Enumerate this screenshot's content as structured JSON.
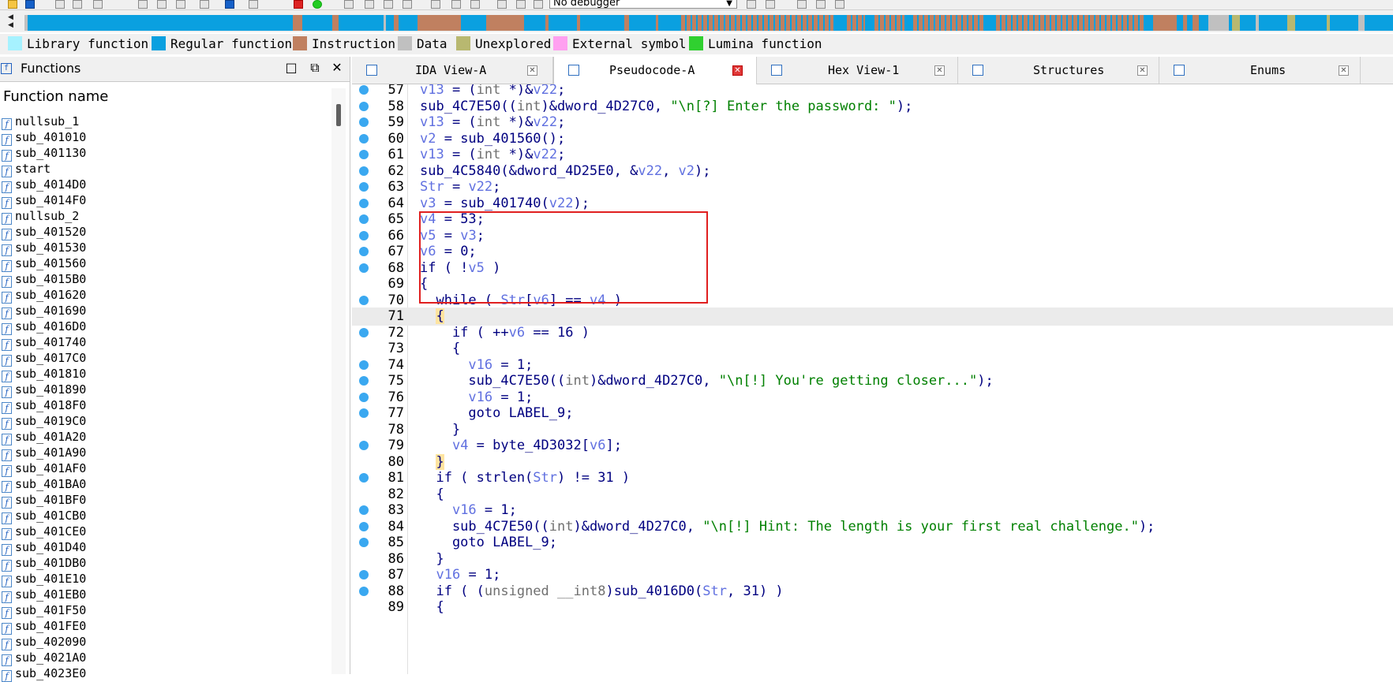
{
  "toolbar": {
    "debugger_label": "No debugger"
  },
  "legend": [
    {
      "label": "Library function",
      "color": "#a6f2ff"
    },
    {
      "label": "Regular function",
      "color": "#0aa0e0"
    },
    {
      "label": "Instruction",
      "color": "#c08060"
    },
    {
      "label": "Data",
      "color": "#c0c0c0"
    },
    {
      "label": "Unexplored",
      "color": "#b8b870"
    },
    {
      "label": "External symbol",
      "color": "#ffa0f0"
    },
    {
      "label": "Lumina function",
      "color": "#30d030"
    }
  ],
  "functions_panel": {
    "title": "Functions",
    "column_header": "Function name",
    "items": [
      "nullsub_1",
      "sub_401010",
      "sub_401130",
      "start",
      "sub_4014D0",
      "sub_4014F0",
      "nullsub_2",
      "sub_401520",
      "sub_401530",
      "sub_401560",
      "sub_4015B0",
      "sub_401620",
      "sub_401690",
      "sub_4016D0",
      "sub_401740",
      "sub_4017C0",
      "sub_401810",
      "sub_401890",
      "sub_4018F0",
      "sub_4019C0",
      "sub_401A20",
      "sub_401A90",
      "sub_401AF0",
      "sub_401BA0",
      "sub_401BF0",
      "sub_401CB0",
      "sub_401CE0",
      "sub_401D40",
      "sub_401DB0",
      "sub_401E10",
      "sub_401EB0",
      "sub_401F50",
      "sub_401FE0",
      "sub_402090",
      "sub_4021A0",
      "sub_4023E0"
    ]
  },
  "tabs": [
    {
      "label": "IDA View-A",
      "active": false
    },
    {
      "label": "Pseudocode-A",
      "active": true
    },
    {
      "label": "Hex View-1",
      "active": false
    },
    {
      "label": "Structures",
      "active": false
    },
    {
      "label": "Enums",
      "active": false
    }
  ],
  "code": {
    "lines": [
      {
        "no": "57",
        "dot": true,
        "text": "v13 = (int *)&v22;"
      },
      {
        "no": "58",
        "dot": true,
        "text": "sub_4C7E50((int)&dword_4D27C0, \"\\n[?] Enter the password: \");"
      },
      {
        "no": "59",
        "dot": true,
        "text": "v13 = (int *)&v22;"
      },
      {
        "no": "60",
        "dot": true,
        "text": "v2 = sub_401560();"
      },
      {
        "no": "61",
        "dot": true,
        "text": "v13 = (int *)&v22;"
      },
      {
        "no": "62",
        "dot": true,
        "text": "sub_4C5840(&dword_4D25E0, &v22, v2);"
      },
      {
        "no": "63",
        "dot": true,
        "text": "Str = v22;"
      },
      {
        "no": "64",
        "dot": true,
        "text": "v3 = sub_401740(v22);"
      },
      {
        "no": "65",
        "dot": true,
        "text": "v4 = 53;"
      },
      {
        "no": "66",
        "dot": true,
        "text": "v5 = v3;"
      },
      {
        "no": "67",
        "dot": true,
        "text": "v6 = 0;"
      },
      {
        "no": "68",
        "dot": true,
        "text": "if ( !v5 )"
      },
      {
        "no": "69",
        "dot": false,
        "text": "{"
      },
      {
        "no": "70",
        "dot": true,
        "text": "  while ( Str[v6] == v4 )"
      },
      {
        "no": "71",
        "dot": false,
        "text": "  {"
      },
      {
        "no": "72",
        "dot": true,
        "text": "    if ( ++v6 == 16 )"
      },
      {
        "no": "73",
        "dot": false,
        "text": "    {"
      },
      {
        "no": "74",
        "dot": true,
        "text": "      v16 = 1;"
      },
      {
        "no": "75",
        "dot": true,
        "text": "      sub_4C7E50((int)&dword_4D27C0, \"\\n[!] You're getting closer...\");"
      },
      {
        "no": "76",
        "dot": true,
        "text": "      v16 = 1;"
      },
      {
        "no": "77",
        "dot": true,
        "text": "      goto LABEL_9;"
      },
      {
        "no": "78",
        "dot": false,
        "text": "    }"
      },
      {
        "no": "79",
        "dot": true,
        "text": "    v4 = byte_4D3032[v6];"
      },
      {
        "no": "80",
        "dot": false,
        "text": "  }"
      },
      {
        "no": "81",
        "dot": true,
        "text": "  if ( strlen(Str) != 31 )"
      },
      {
        "no": "82",
        "dot": false,
        "text": "  {"
      },
      {
        "no": "83",
        "dot": true,
        "text": "    v16 = 1;"
      },
      {
        "no": "84",
        "dot": true,
        "text": "    sub_4C7E50((int)&dword_4D27C0, \"\\n[!] Hint: The length is your first real challenge.\");"
      },
      {
        "no": "85",
        "dot": true,
        "text": "    goto LABEL_9;"
      },
      {
        "no": "86",
        "dot": false,
        "text": "  }"
      },
      {
        "no": "87",
        "dot": true,
        "text": "  v16 = 1;"
      },
      {
        "no": "88",
        "dot": true,
        "text": "  if ( (unsigned __int8)sub_4016D0(Str, 31) )"
      },
      {
        "no": "89",
        "dot": false,
        "text": "  {"
      }
    ]
  }
}
